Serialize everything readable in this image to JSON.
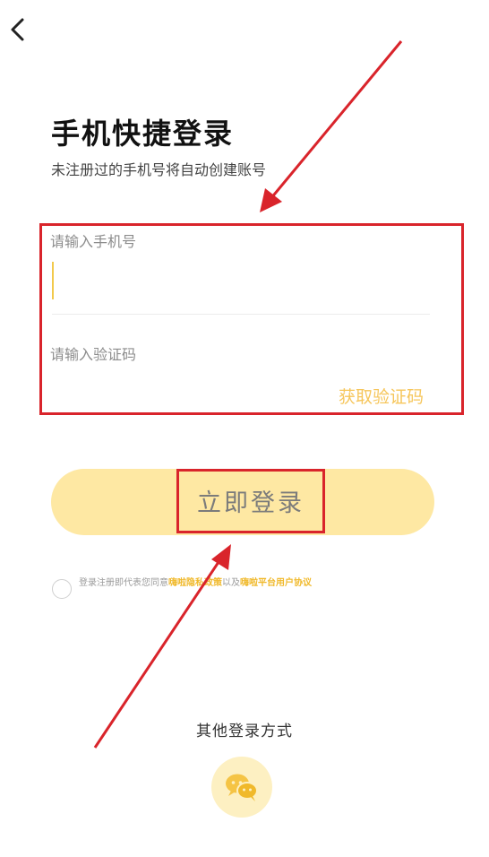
{
  "header": {
    "title": "手机快捷登录",
    "subtitle": "未注册过的手机号将自动创建账号"
  },
  "form": {
    "phone_placeholder": "请输入手机号",
    "code_placeholder": "请输入验证码",
    "get_code_label": "获取验证码"
  },
  "login_button": {
    "label": "立即登录"
  },
  "agreement": {
    "prefix": "登录注册即代表您同意",
    "privacy_link": "嗨啦隐私政策",
    "middle": "以及",
    "terms_link": "嗨啦平台用户协议"
  },
  "other_login": {
    "label": "其他登录方式",
    "wechat_icon": "wechat-icon"
  },
  "colors": {
    "accent_yellow": "#f6c65b",
    "button_bg": "#fee8a3",
    "annotation_red": "#d9242b",
    "wechat_bg": "#fdf0c2"
  }
}
